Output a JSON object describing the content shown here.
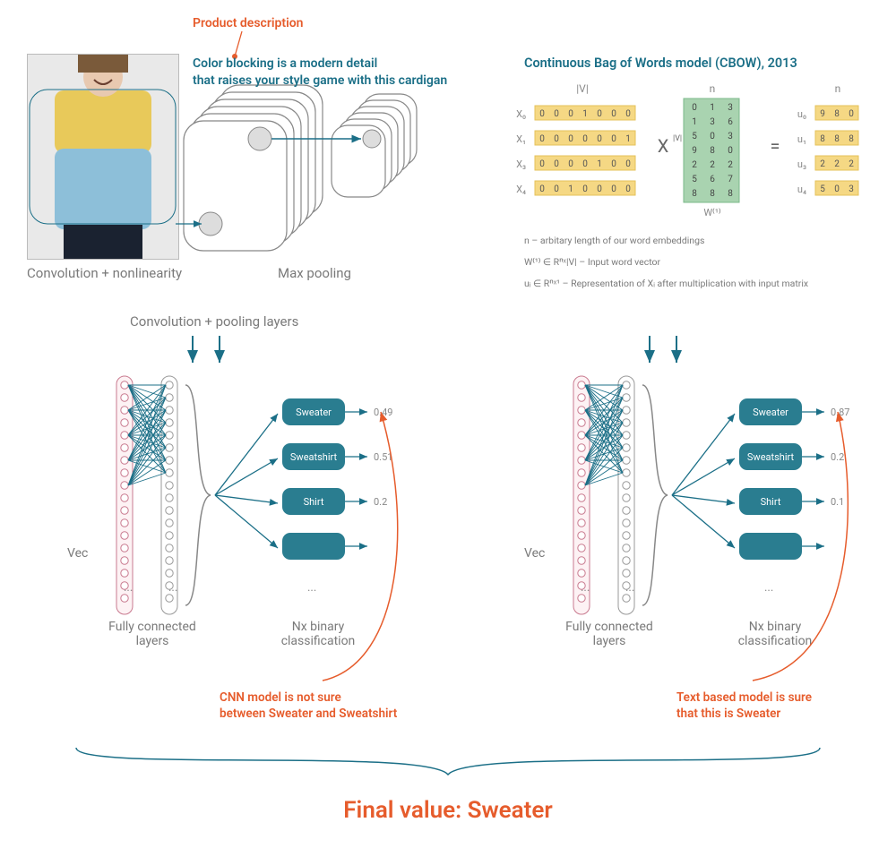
{
  "annotations": {
    "product_desc_label": "Product description",
    "product_desc_text_1": "Color blocking is a modern detail",
    "product_desc_text_2": "that raises your style game with this cardigan",
    "cnn_note_1": "CNN model is not sure",
    "cnn_note_2": "between Sweater and Sweatshirt",
    "text_note_1": "Text based model is sure",
    "text_note_2": "that this is Sweater",
    "final_label": "Final value: Sweater"
  },
  "cnn": {
    "conv_label": "Convolution + nonlinearity",
    "pool_label": "Max pooling",
    "conv_pool_header": "Convolution + pooling layers",
    "vec_label": "Vec",
    "dots": "...",
    "fc_label": "Fully connected\nlayers",
    "nx_label": "Nx binary\nclassification",
    "outputs": [
      {
        "label": "Sweater",
        "score": "0.49"
      },
      {
        "label": "Sweatshirt",
        "score": "0.51"
      },
      {
        "label": "Shirt",
        "score": "0.2"
      },
      {
        "label": "",
        "score": ""
      }
    ]
  },
  "cbow": {
    "title": "Continuous Bag of Words model (CBOW), 2013",
    "col_V": "|V|",
    "col_n_1": "n",
    "col_n_2": "n",
    "x_op": "X",
    "eq_op": "=",
    "sup_v": "|V|",
    "w_label": "W₁₁₁",
    "x_rows": [
      {
        "name": "X₀",
        "vals": [
          "0",
          "0",
          "0",
          "1",
          "0",
          "0",
          "0"
        ]
      },
      {
        "name": "X₁",
        "vals": [
          "0",
          "0",
          "0",
          "0",
          "0",
          "0",
          "1"
        ]
      },
      {
        "name": "X₃",
        "vals": [
          "0",
          "0",
          "0",
          "0",
          "1",
          "0",
          "0"
        ]
      },
      {
        "name": "X₄",
        "vals": [
          "0",
          "0",
          "1",
          "0",
          "0",
          "0",
          "0"
        ]
      }
    ],
    "w_matrix": [
      [
        "0",
        "1",
        "3"
      ],
      [
        "1",
        "3",
        "6"
      ],
      [
        "5",
        "0",
        "3"
      ],
      [
        "9",
        "8",
        "0"
      ],
      [
        "2",
        "2",
        "2"
      ],
      [
        "5",
        "6",
        "7"
      ],
      [
        "8",
        "8",
        "8"
      ]
    ],
    "u_rows": [
      {
        "name": "u₀",
        "vals": [
          "9",
          "8",
          "0"
        ]
      },
      {
        "name": "u₁",
        "vals": [
          "8",
          "8",
          "8"
        ]
      },
      {
        "name": "u₃",
        "vals": [
          "2",
          "2",
          "2"
        ]
      },
      {
        "name": "u₄",
        "vals": [
          "5",
          "0",
          "3"
        ]
      }
    ],
    "caption_1": "n – arbitary length of our word embeddings",
    "caption_2": "W⁽¹⁾ ∈ Rⁿˣ|V| – Input word vector",
    "caption_3": "uᵢ ∈ Rⁿˣ¹ – Representation of Xᵢ after multiplication with input matrix"
  },
  "text_model": {
    "vec_label": "Vec",
    "dots": "...",
    "fc_label": "Fully connected\nlayers",
    "nx_label": "Nx binary\nclassification",
    "outputs": [
      {
        "label": "Sweater",
        "score": "0.87"
      },
      {
        "label": "Sweatshirt",
        "score": "0.2"
      },
      {
        "label": "Shirt",
        "score": "0.1"
      },
      {
        "label": "",
        "score": ""
      }
    ]
  }
}
